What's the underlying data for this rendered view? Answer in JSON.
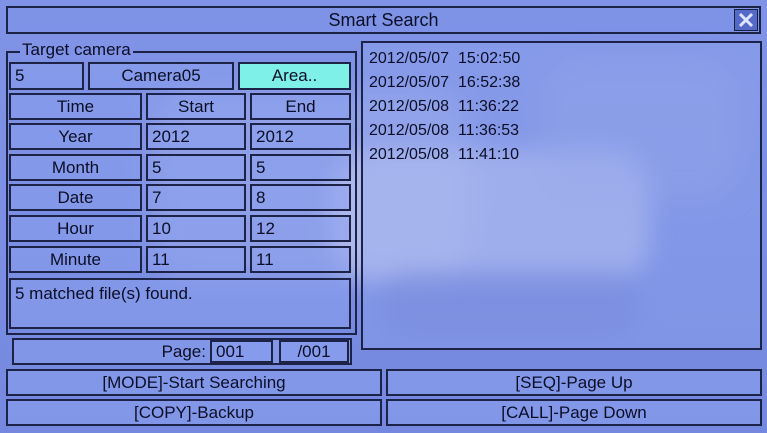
{
  "window": {
    "title": "Smart Search"
  },
  "target": {
    "group_label": "Target camera",
    "camera_no": "5",
    "camera_name": "Camera05",
    "area_button": "Area.."
  },
  "table": {
    "headers": [
      "Time",
      "Start",
      "End"
    ],
    "rows": [
      {
        "label": "Year",
        "start": "2012",
        "end": "2012"
      },
      {
        "label": "Month",
        "start": "5",
        "end": "5"
      },
      {
        "label": "Date",
        "start": "7",
        "end": "8"
      },
      {
        "label": "Hour",
        "start": "10",
        "end": "12"
      },
      {
        "label": "Minute",
        "start": "11",
        "end": "11"
      }
    ]
  },
  "status_text": "5 matched file(s) found.",
  "page": {
    "label": "Page:",
    "current": "001",
    "total": "/001"
  },
  "results": [
    "2012/05/07  15:02:50",
    "2012/05/07  16:52:38",
    "2012/05/08  11:36:22",
    "2012/05/08  11:36:53",
    "2012/05/08  11:41:10"
  ],
  "buttons": {
    "start_search": "[MODE]-Start Searching",
    "page_up": "[SEQ]-Page Up",
    "backup": "[COPY]-Backup",
    "page_down": "[CALL]-Page Down"
  },
  "icons": {
    "close": "close-icon"
  },
  "colors": {
    "background": "#7f93e6",
    "area_button": "#7ff0e8",
    "border": "#1d2347"
  }
}
